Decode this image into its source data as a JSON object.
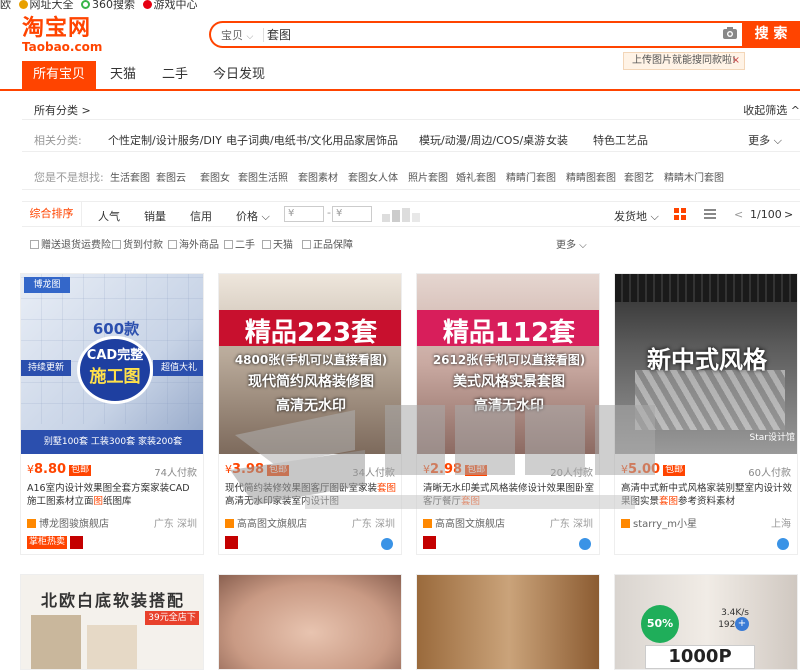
{
  "bookmarks": [
    {
      "label": "欧",
      "icon": ""
    },
    {
      "label": "网址大全",
      "icon": "grid-icon",
      "color": "#e8a000"
    },
    {
      "label": "360搜索",
      "icon": "360-icon",
      "color": "#39b54a"
    },
    {
      "label": "游戏中心",
      "icon": "game-icon",
      "color": "#e60012"
    }
  ],
  "logo": {
    "name": "淘宝网",
    "domain": "Taobao.com"
  },
  "search": {
    "scope": "宝贝",
    "query": "套图",
    "button": "搜 索"
  },
  "tooltip": {
    "text": "上传图片就能搜同款啦!",
    "close": "×"
  },
  "tabs": [
    "所有宝贝",
    "天猫",
    "二手",
    "今日发现"
  ],
  "crumb": {
    "all": "所有分类 >",
    "collapse": "收起筛选 ^"
  },
  "related": {
    "label": "相关分类:",
    "items": [
      "个性定制/设计服务/DIY",
      "电子词典/电纸书/文化用品",
      "家居饰品",
      "模玩/动漫/周边/COS/桌游",
      "女装",
      "特色工艺品"
    ],
    "more": "更多 ⌵"
  },
  "suggest": {
    "label": "您是不是想找:",
    "items": [
      "生活套图",
      "套图云",
      "套图女",
      "套图生活照",
      "套图素材",
      "套图女人体",
      "照片套图",
      "婚礼套图",
      "精睛门套图",
      "精睛图套图",
      "套图艺",
      "精睛木门套图"
    ]
  },
  "sort": {
    "items": [
      "综合排序",
      "人气",
      "销量",
      "信用",
      "价格 ⌵"
    ],
    "price_from": "¥",
    "price_to": "¥",
    "ship": "发货地 ⌵",
    "page": "1/100",
    "prev": "<",
    "next": ">"
  },
  "filters": {
    "items": [
      "赠送退货运费险",
      "货到付款",
      "海外商品",
      "二手",
      "天猫",
      "正品保障"
    ],
    "more": "更多 ⌵"
  },
  "products": [
    {
      "price": "8.80",
      "sold": "74人付款",
      "title_pre": "A16室内设计效果图全套方案家装CAD施工图素材立面",
      "title_hl": "图",
      "title_post": "纸图库",
      "shop": "博龙图骏旗舰店",
      "loc": "广东 深圳",
      "badge1": "掌柜热卖",
      "banner1": "600款",
      "banner2": "CAD完整",
      "banner3": "施工图",
      "banner4": "别墅100套 工装300套 家装200套",
      "side1": "持续更新",
      "side2": "超值大礼"
    },
    {
      "price": "3.98",
      "sold": "34人付款",
      "title_pre": "现代简约装修效果图客厅图卧室家装",
      "title_hl": "套图",
      "title_post": "高清无水印家装室内设计图",
      "shop": "高高图文旗舰店",
      "loc": "广东 深圳",
      "big1": "精品223套",
      "big2": "4800张(手机可以直接看图)",
      "big3": "现代简约风格装修图",
      "big4": "高清无水印"
    },
    {
      "price": "2.98",
      "sold": "20人付款",
      "title_pre": "清晰无水印美式风格装修设计效果图卧室客厅餐厅",
      "title_hl": "套图",
      "title_post": "",
      "shop": "高高图文旗舰店",
      "loc": "广东 深圳",
      "big1": "精品112套",
      "big2": "2612张(手机可以直接看图)",
      "big3": "美式风格实景套图",
      "big4": "高清无水印"
    },
    {
      "price": "5.00",
      "sold": "60人付款",
      "title_pre": "高清中式新中式风格家装别墅室内设计效果图实景",
      "title_hl": "套图",
      "title_post": "参考资料素材",
      "shop": "starry_m小星",
      "loc": "上海",
      "big1": "新中式风格",
      "sig": "Star设计馆"
    }
  ],
  "row2": {
    "t1": "北欧白底软装搭配",
    "t1b": "39元全店下",
    "t4": "1000P",
    "t4b": "50%",
    "speed1": "3.4K/s",
    "speed2": "192K/s"
  },
  "colors": {
    "accent": "#ff4400",
    "link": "#3a93e6"
  }
}
